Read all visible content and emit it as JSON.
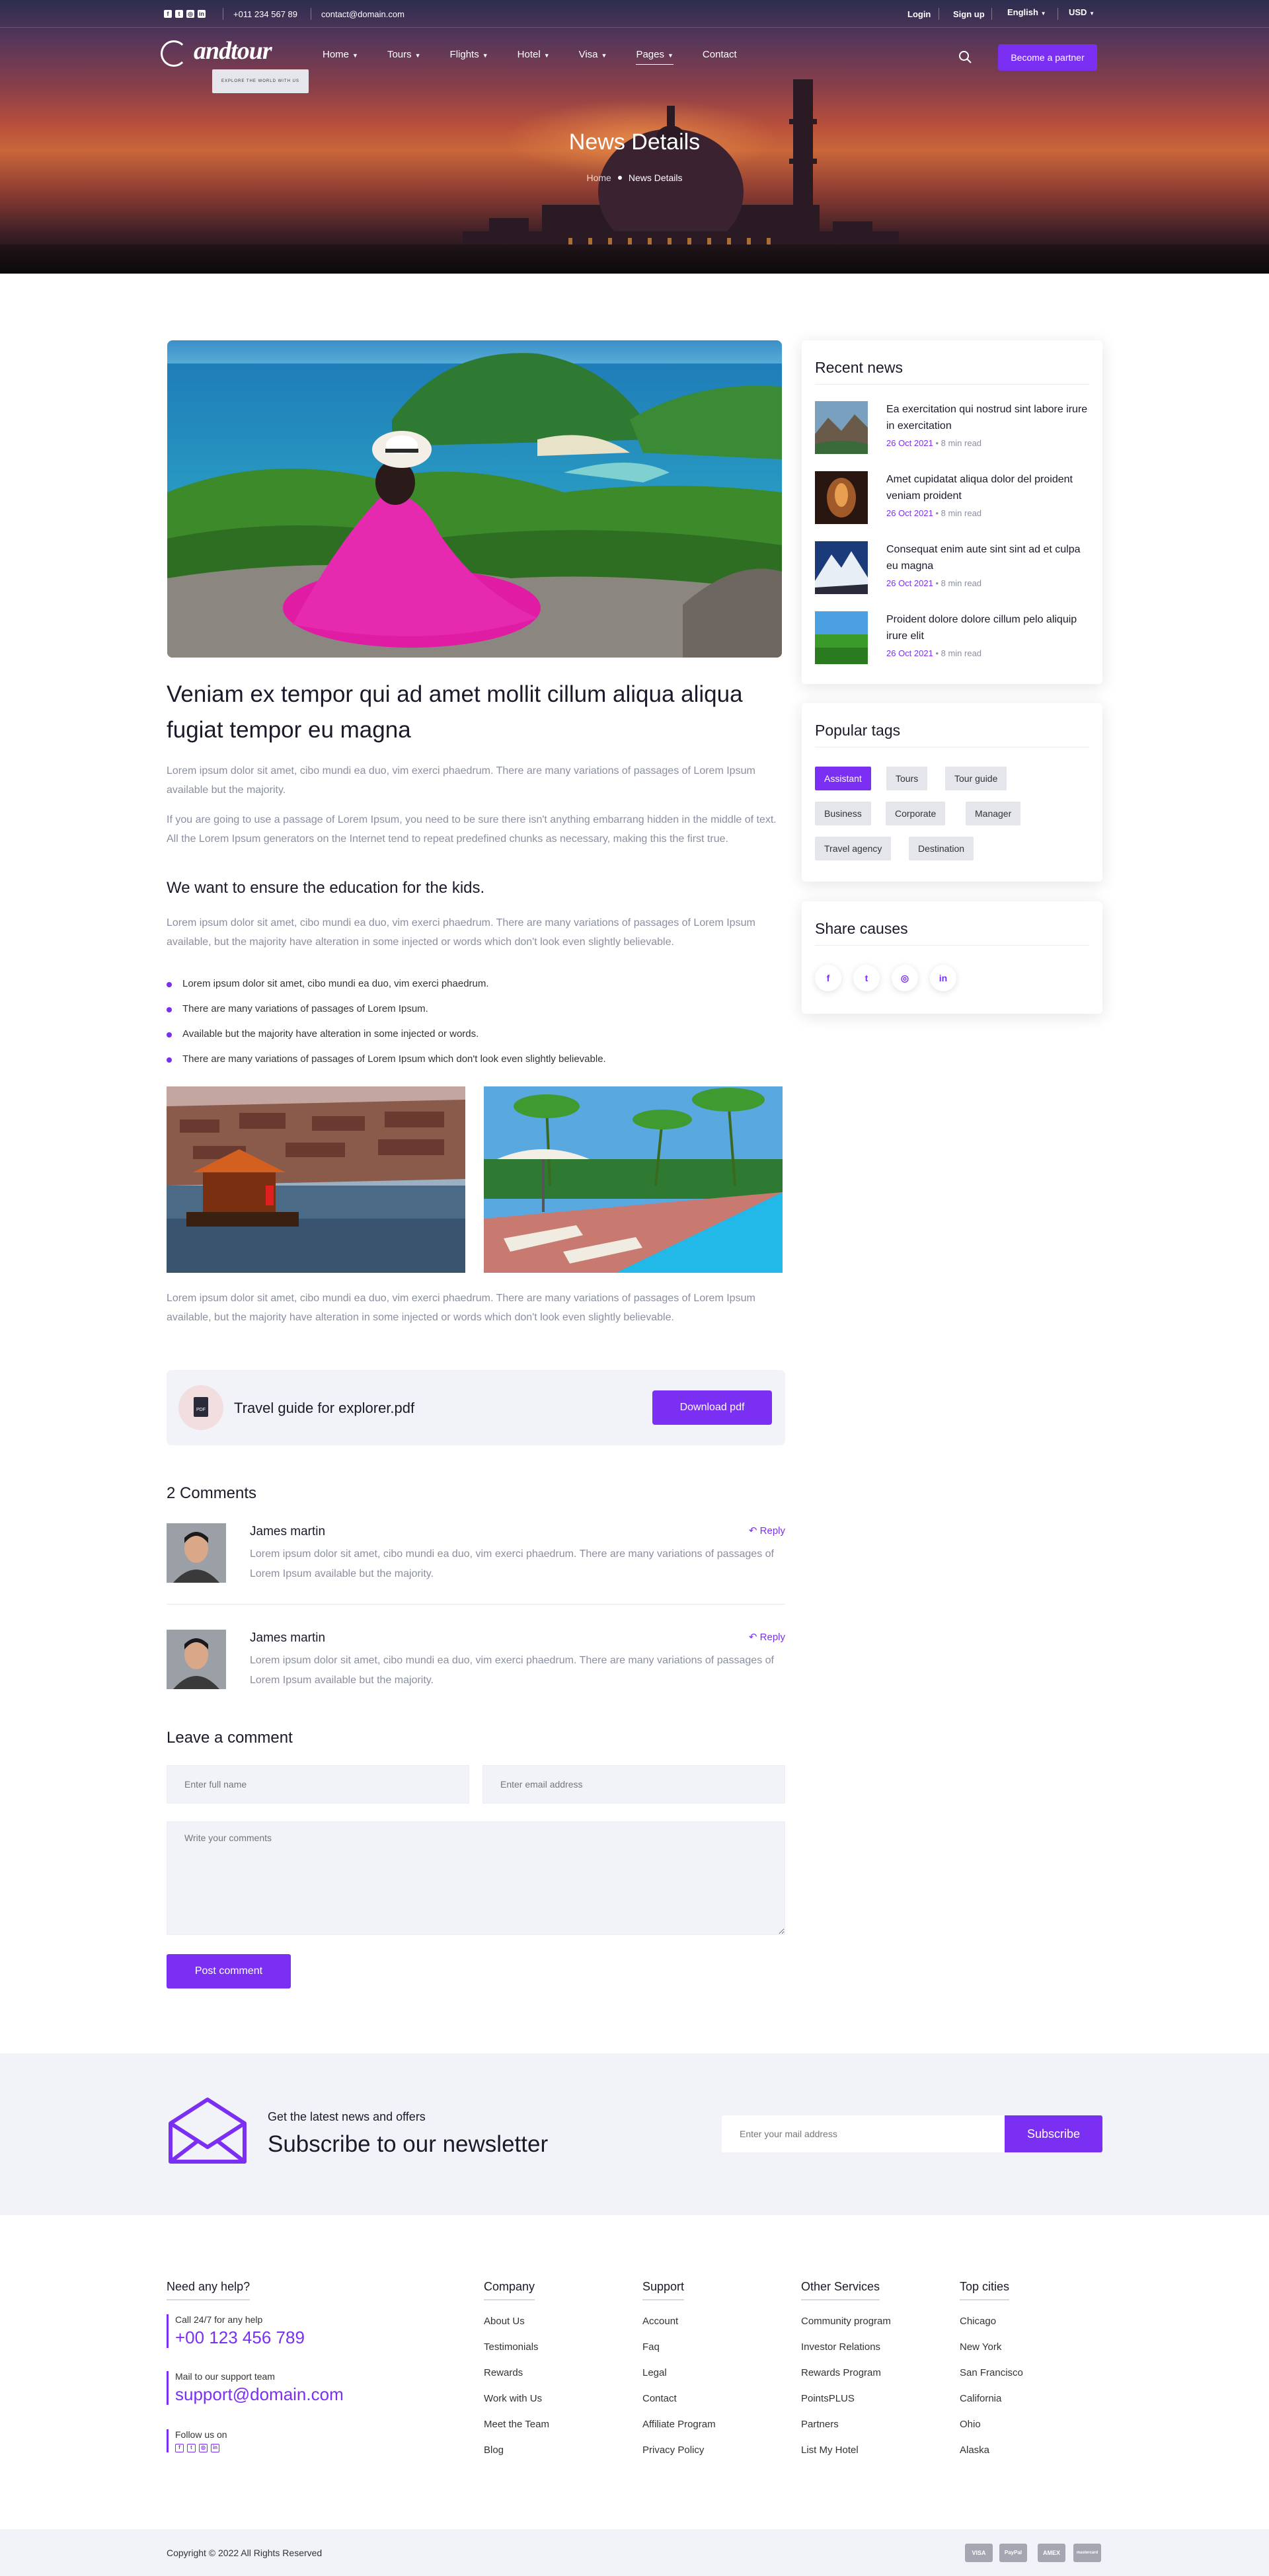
{
  "topbar": {
    "phone": "+011 234 567 89",
    "email": "contact@domain.com",
    "login": "Login",
    "signup": "Sign up",
    "language": "English",
    "currency": "USD"
  },
  "brand": {
    "name": "andtour",
    "tagline": "EXPLORE THE WORLD WITH US"
  },
  "nav": {
    "items": [
      {
        "label": "Home"
      },
      {
        "label": "Tours"
      },
      {
        "label": "Flights"
      },
      {
        "label": "Hotel"
      },
      {
        "label": "Visa"
      },
      {
        "label": "Pages"
      },
      {
        "label": "Contact"
      }
    ],
    "partner_button": "Become a partner"
  },
  "hero": {
    "title": "News Details",
    "crumb_home": "Home",
    "crumb_current": "News Details"
  },
  "article": {
    "title": "Veniam ex tempor qui ad amet mollit cillum aliqua aliqua fugiat tempor eu magna",
    "p1": "Lorem ipsum dolor sit amet, cibo mundi ea duo, vim exerci phaedrum. There are many variations of passages of Lorem Ipsum available but the majority.",
    "p2": "If you are going to use a passage of Lorem Ipsum, you need to be sure there isn't anything embarrang hidden in the middle of text. All the Lorem Ipsum generators on the Internet tend to repeat predefined chunks as necessary, making this the first true.",
    "subheading": "We want to ensure the education for the kids.",
    "p3": "Lorem ipsum dolor sit amet, cibo mundi ea duo, vim exerci phaedrum. There are many variations of passages of Lorem Ipsum available, but the majority have alteration in some injected or words which don't look even slightly believable.",
    "bullets": [
      "Lorem ipsum dolor sit amet, cibo mundi ea duo, vim exerci phaedrum.",
      "There are many variations of passages of Lorem Ipsum.",
      "Available but the majority have alteration in some injected or words.",
      "There are many variations of passages of Lorem Ipsum which don't look even slightly believable."
    ],
    "p4": "Lorem ipsum dolor sit amet, cibo mundi ea duo, vim exerci phaedrum. There are many variations of passages of Lorem Ipsum available, but the majority have alteration in some injected or words which don't look even slightly believable.",
    "pdf_name": "Travel guide for explorer.pdf",
    "pdf_button": "Download pdf"
  },
  "comments": {
    "heading": "2 Comments",
    "items": [
      {
        "name": "James martin",
        "reply": "Reply",
        "text": "Lorem ipsum dolor sit amet, cibo mundi ea duo, vim exerci phaedrum. There are many variations of passages of Lorem Ipsum available but the majority."
      },
      {
        "name": "James martin",
        "reply": "Reply",
        "text": "Lorem ipsum dolor sit amet, cibo mundi ea duo, vim exerci phaedrum. There are many variations of passages of Lorem Ipsum available but the majority."
      }
    ]
  },
  "form": {
    "heading": "Leave a comment",
    "name_placeholder": "Enter full name",
    "email_placeholder": "Enter email address",
    "comment_placeholder": "Write your comments",
    "submit": "Post comment"
  },
  "sidebar": {
    "recent_title": "Recent news",
    "recent": [
      {
        "title": "Ea exercitation qui nostrud sint labore irure in exercitation",
        "date": "26 Oct 2021",
        "read": "8 min read"
      },
      {
        "title": "Amet cupidatat aliqua dolor del proident veniam proident",
        "date": "26 Oct 2021",
        "read": "8 min read"
      },
      {
        "title": "Consequat enim aute sint sint ad et culpa eu magna",
        "date": "26 Oct 2021",
        "read": "8 min read"
      },
      {
        "title": "Proident dolore dolore cillum pelo aliquip irure elit",
        "date": "26 Oct 2021",
        "read": "8 min read"
      }
    ],
    "tags_title": "Popular tags",
    "tags": [
      "Assistant",
      "Tours",
      "Tour guide",
      "Business",
      "Corporate",
      "Manager",
      "Travel agency",
      "Destination"
    ],
    "share_title": "Share causes"
  },
  "newsletter": {
    "small": "Get the latest news and offers",
    "big": "Subscribe to our newsletter",
    "placeholder": "Enter your mail address",
    "button": "Subscribe"
  },
  "footer": {
    "help": {
      "heading": "Need any help?",
      "call_label": "Call 24/7 for any help",
      "phone": "+00 123 456 789",
      "mail_label": "Mail to our support team",
      "email": "support@domain.com",
      "follow": "Follow us on"
    },
    "columns": [
      {
        "heading": "Company",
        "links": [
          "About Us",
          "Testimonials",
          "Rewards",
          "Work with Us",
          "Meet the Team",
          "Blog"
        ]
      },
      {
        "heading": "Support",
        "links": [
          "Account",
          "Faq",
          "Legal",
          "Contact",
          "Affiliate Program",
          "Privacy Policy"
        ]
      },
      {
        "heading": "Other Services",
        "links": [
          "Community program",
          "Investor Relations",
          "Rewards Program",
          "PointsPLUS",
          "Partners",
          "List My Hotel"
        ]
      },
      {
        "heading": "Top cities",
        "links": [
          "Chicago",
          "New York",
          "San Francisco",
          "California",
          "Ohio",
          "Alaska"
        ]
      }
    ],
    "copyright": "Copyright © 2022 All Rights Reserved",
    "payments": [
      "VISA",
      "PayPal",
      "AMEX",
      "mastercard"
    ]
  },
  "colors": {
    "accent": "#7b2ff2",
    "muted_text": "#8a8fa0",
    "light_bg": "#f2f3f8"
  }
}
